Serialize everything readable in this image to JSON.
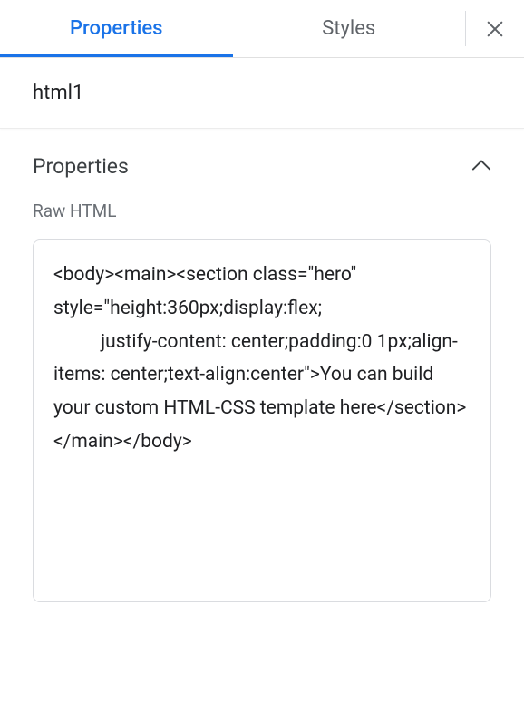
{
  "tabs": {
    "properties": "Properties",
    "styles": "Styles"
  },
  "element_name": "html1",
  "section": {
    "title": "Properties",
    "field_label": "Raw HTML",
    "raw_html": "<body><main><section class=\"hero\" style=\"height:360px;display:flex;\n          justify-content: center;padding:0 1px;align-items: center;text-align:center\">You can build your custom HTML-CSS template here</section></main></body>"
  }
}
